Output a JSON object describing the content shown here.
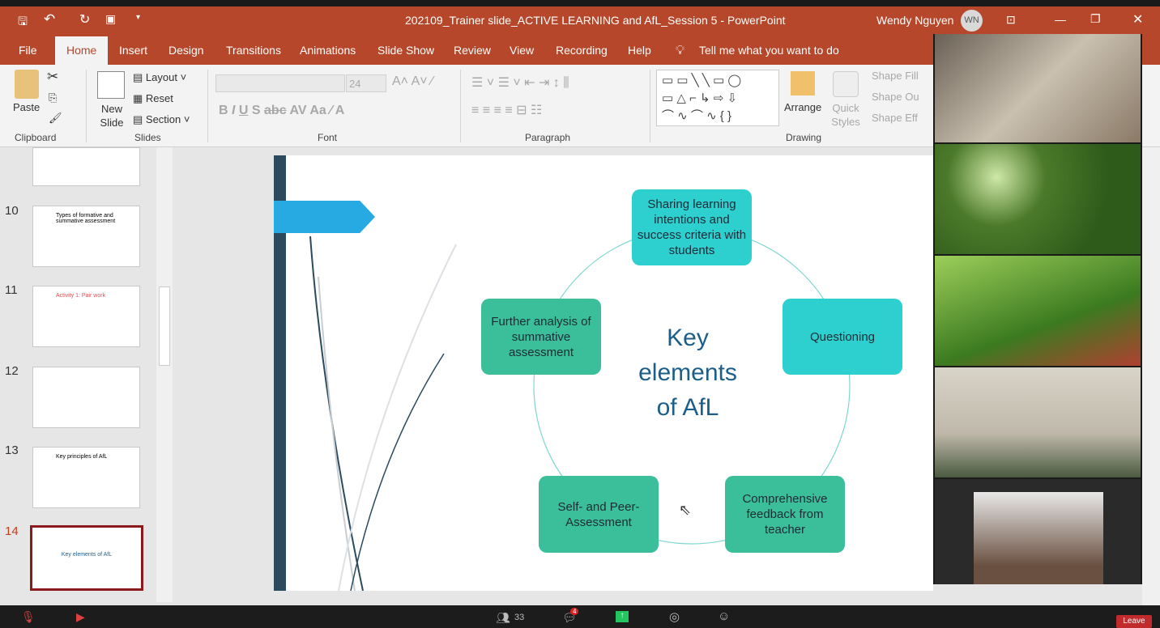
{
  "titlebar": {
    "doc_title": "202109_Trainer slide_ACTIVE LEARNING and AfL_Session 5  -  PowerPoint",
    "user_name": "Wendy Nguyen",
    "user_initials": "WN"
  },
  "tabs": [
    "File",
    "Home",
    "Insert",
    "Design",
    "Transitions",
    "Animations",
    "Slide Show",
    "Review",
    "View",
    "Recording",
    "Help"
  ],
  "tell_me": "Tell me what you want to do",
  "ribbon": {
    "paste": "Paste",
    "new_slide": "New Slide",
    "layout": "Layout",
    "reset": "Reset",
    "section": "Section",
    "font_size": "24",
    "arrange": "Arrange",
    "quick_styles": "Quick Styles",
    "shape_fill": "Shape Fill",
    "shape_outline": "Shape Ou",
    "shape_effects": "Shape Eff",
    "groups": {
      "clipboard": "Clipboard",
      "slides": "Slides",
      "font": "Font",
      "paragraph": "Paragraph",
      "drawing": "Drawing"
    }
  },
  "thumbnails": [
    {
      "num": "10",
      "title": "Types of formative and summative assessment"
    },
    {
      "num": "11",
      "title": "Activity 1: Pair work"
    },
    {
      "num": "12",
      "title": ""
    },
    {
      "num": "13",
      "title": "Key principles of AfL"
    },
    {
      "num": "14",
      "title": "Key elements of AfL",
      "active": true
    }
  ],
  "slide": {
    "center_title": "Key elements of AfL",
    "boxes": {
      "top": "Sharing learning intentions and success criteria with students",
      "right": "Questioning",
      "bottom_right": "Comprehensive feedback from teacher",
      "bottom_left": "Self- and Peer-Assessment",
      "left": "Further analysis of summative assessment"
    },
    "colors": {
      "teal": "#2ecfcf",
      "green": "#3bbf9a"
    }
  },
  "zoom": {
    "participants": "33",
    "chat_badge": "4",
    "leave": "Leave"
  }
}
